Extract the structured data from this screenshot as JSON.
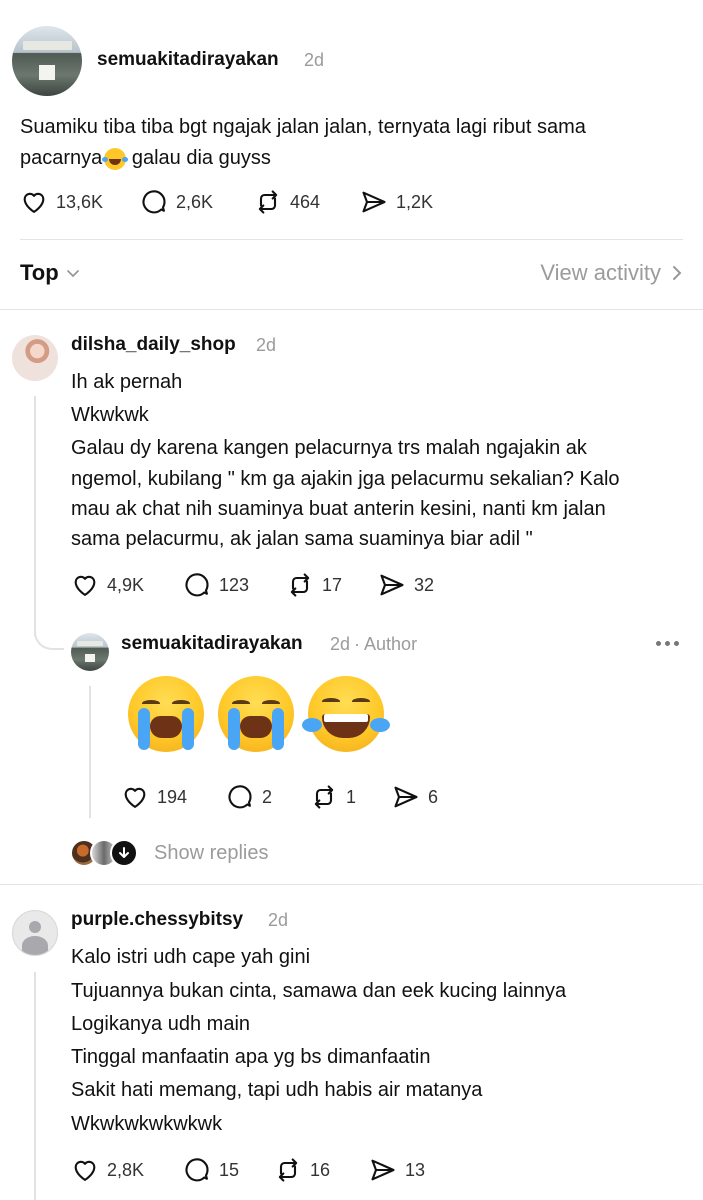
{
  "post": {
    "username": "semuakitadirayakan",
    "time": "2d",
    "text_line1": "Suamiku tiba tiba bgt ngajak jalan jalan, ternyata lagi ribut sama",
    "text_line2_a": "pacarnya",
    "text_line2_b": " galau dia guyss",
    "likes": "13,6K",
    "replies": "2,6K",
    "reposts": "464",
    "shares": "1,2K"
  },
  "sort": {
    "label": "Top",
    "view_activity": "View activity"
  },
  "comments": [
    {
      "username": "dilsha_daily_shop",
      "time": "2d",
      "lines": [
        "Ih ak pernah",
        "Wkwkwk",
        "Galau dy karena kangen pelacurnya trs malah ngajakin ak",
        "ngemol, kubilang \" km ga ajakin jga pelacurmu sekalian? Kalo",
        "mau ak chat nih suaminya buat anterin kesini, nanti km jalan",
        "sama pelacurmu, ak jalan sama suaminya biar adil \""
      ],
      "likes": "4,9K",
      "replies": "123",
      "reposts": "17",
      "shares": "32"
    },
    {
      "username": "purple.chessybitsy",
      "time": "2d",
      "lines": [
        "Kalo istri udh cape yah gini",
        "Tujuannya bukan cinta, samawa dan eek kucing lainnya",
        "Logikanya udh main",
        "Tinggal manfaatin apa yg bs dimanfaatin",
        "Sakit hati memang, tapi udh habis air matanya",
        "Wkwkwkwkwkwk"
      ],
      "likes": "2,8K",
      "replies": "15",
      "reposts": "16",
      "shares": "13"
    }
  ],
  "nested_reply": {
    "username": "semuakitadirayakan",
    "time": "2d",
    "author_tag": "· Author",
    "emojis": [
      "loudly-crying-face",
      "loudly-crying-face",
      "tears-of-joy-face"
    ],
    "likes": "194",
    "replies": "2",
    "reposts": "1",
    "shares": "6"
  },
  "show_replies": "Show replies"
}
